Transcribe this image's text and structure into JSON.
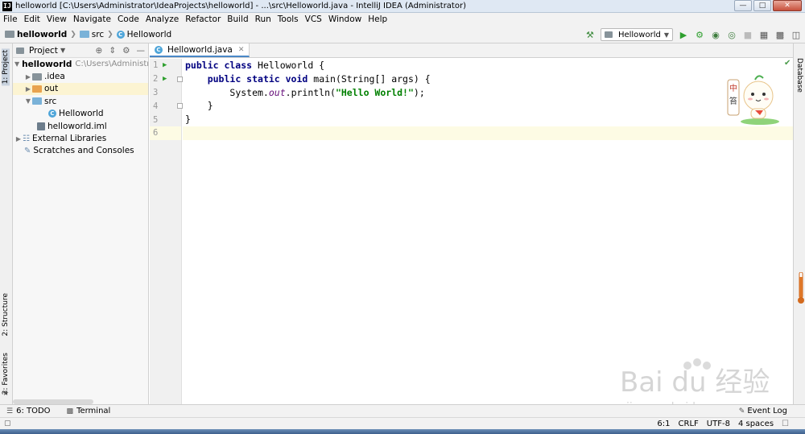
{
  "window": {
    "title": "helloworld [C:\\Users\\Administrator\\IdeaProjects\\helloworld] - ...\\src\\Helloworld.java - IntelliJ IDEA (Administrator)",
    "logo": "IJ"
  },
  "menu": [
    "File",
    "Edit",
    "View",
    "Navigate",
    "Code",
    "Analyze",
    "Refactor",
    "Build",
    "Run",
    "Tools",
    "VCS",
    "Window",
    "Help"
  ],
  "breadcrumb": {
    "project": "helloworld",
    "folder": "src",
    "file": "Helloworld"
  },
  "toolbar": {
    "run_config": "Helloworld"
  },
  "left_tabs": {
    "project": "1: Project",
    "structure": "2: Structure",
    "favorites": "2: Favorites"
  },
  "right_tabs": {
    "database": "Database"
  },
  "project_panel": {
    "title": "Project",
    "tree": [
      {
        "label": "helloworld",
        "path": "C:\\Users\\Administrat",
        "bold": true
      },
      {
        "label": ".idea"
      },
      {
        "label": "out"
      },
      {
        "label": "src"
      },
      {
        "label": "Helloworld"
      },
      {
        "label": "helloworld.iml"
      },
      {
        "label": "External Libraries"
      },
      {
        "label": "Scratches and Consoles"
      }
    ]
  },
  "editor": {
    "tab_label": "Helloworld.java",
    "line_numbers": [
      "1",
      "2",
      "3",
      "4",
      "5",
      "6"
    ],
    "code": {
      "l1_kw": "public class ",
      "l1_rest": "Helloworld {",
      "l2_indent": "    ",
      "l2_kw": "public static void ",
      "l2_rest": "main(String[] args) {",
      "l3_indent": "        ",
      "l3_a": "System.",
      "l3_field": "out",
      "l3_b": ".println(",
      "l3_str": "\"Hello World!\"",
      "l3_c": ");",
      "l4": "    }",
      "l5": "}",
      "l6": ""
    },
    "mascot_text": "中\n笞"
  },
  "bottom_tools": {
    "todo": "6: TODO",
    "terminal": "Terminal",
    "event_log": "Event Log"
  },
  "status": {
    "position": "6:1",
    "line_sep": "CRLF",
    "encoding": "UTF-8",
    "indent": "4 spaces"
  },
  "watermark": {
    "brand": "Bai du 经验",
    "url": "jingyan.baidu.com"
  },
  "colors": {
    "keyword": "#000080",
    "string": "#008000",
    "field": "#660e7a",
    "run_green": "#2e9f2e",
    "selection": "#fcf4d2"
  }
}
